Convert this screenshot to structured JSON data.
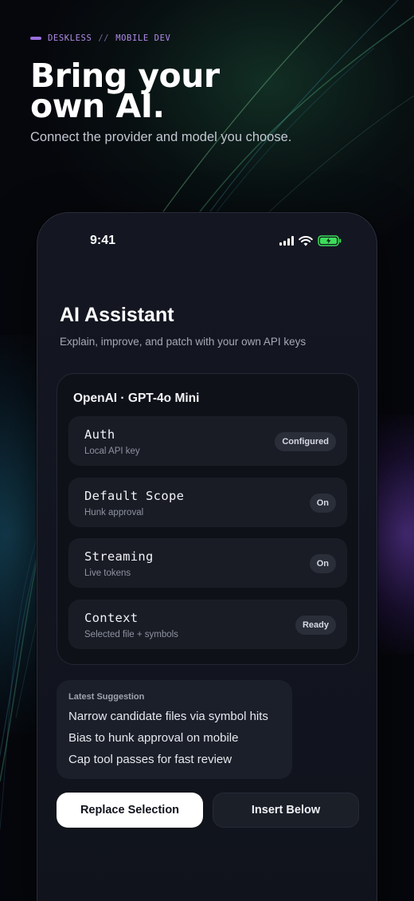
{
  "hero": {
    "brand": "DESKLESS",
    "separator": "//",
    "section": "MOBILE DEV",
    "headline_line1": "Bring your",
    "headline_line2": "own AI.",
    "subtitle": "Connect the provider and model you choose."
  },
  "status_bar": {
    "time": "9:41",
    "battery_color": "#3ddc5a"
  },
  "screen": {
    "title": "AI Assistant",
    "description": "Explain, improve, and patch with your own API keys"
  },
  "provider_card": {
    "title": "OpenAI · GPT-4o Mini",
    "rows": [
      {
        "title": "Auth",
        "subtitle": "Local API key",
        "badge": "Configured"
      },
      {
        "title": "Default Scope",
        "subtitle": "Hunk approval",
        "badge": "On"
      },
      {
        "title": "Streaming",
        "subtitle": "Live tokens",
        "badge": "On"
      },
      {
        "title": "Context",
        "subtitle": "Selected file + symbols",
        "badge": "Ready"
      }
    ]
  },
  "suggestion": {
    "heading": "Latest Suggestion",
    "items": [
      "Narrow candidate files via symbol hits",
      "Bias to hunk approval on mobile",
      "Cap tool passes for fast review"
    ]
  },
  "actions": {
    "primary": "Replace Selection",
    "secondary": "Insert Below"
  },
  "colors": {
    "accent_violet": "#9a6fe0",
    "background": "#06070c"
  }
}
